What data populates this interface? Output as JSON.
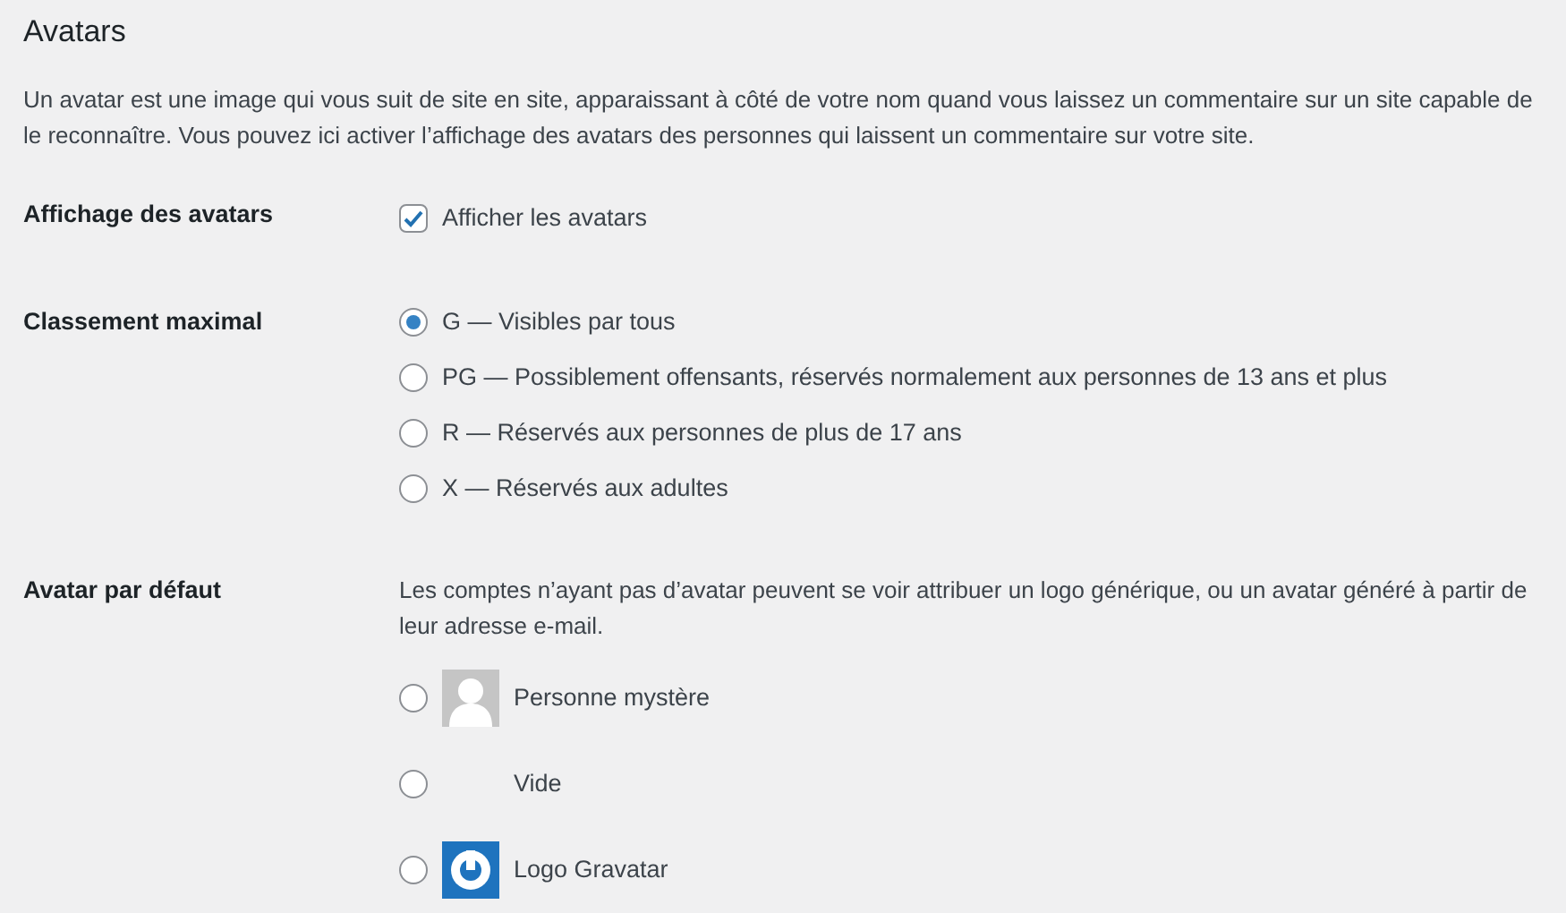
{
  "title": "Avatars",
  "description": "Un avatar est une image qui vous suit de site en site, apparaissant à côté de votre nom quand vous laissez un commentaire sur un site capable de le reconnaître. Vous pouvez ici activer l’affichage des avatars des personnes qui laissent un commentaire sur votre site.",
  "show_avatars": {
    "label": "Affichage des avatars",
    "option": "Afficher les avatars",
    "checked": true
  },
  "rating": {
    "label": "Classement maximal",
    "options": [
      {
        "label": "G — Visibles par tous",
        "selected": true
      },
      {
        "label": "PG — Possiblement offensants, réservés normalement aux personnes de 13 ans et plus",
        "selected": false
      },
      {
        "label": "R — Réservés aux personnes de plus de 17 ans",
        "selected": false
      },
      {
        "label": "X — Réservés aux adultes",
        "selected": false
      }
    ]
  },
  "default_avatar": {
    "label": "Avatar par défaut",
    "description": "Les comptes n’ayant pas d’avatar peuvent se voir attribuer un logo générique, ou un avatar généré à partir de leur adresse e-mail.",
    "options": [
      {
        "kind": "mystery",
        "label": "Personne mystère",
        "selected": false
      },
      {
        "kind": "blank",
        "label": "Vide",
        "selected": false
      },
      {
        "kind": "gravatar",
        "label": "Logo Gravatar",
        "selected": false
      }
    ]
  }
}
